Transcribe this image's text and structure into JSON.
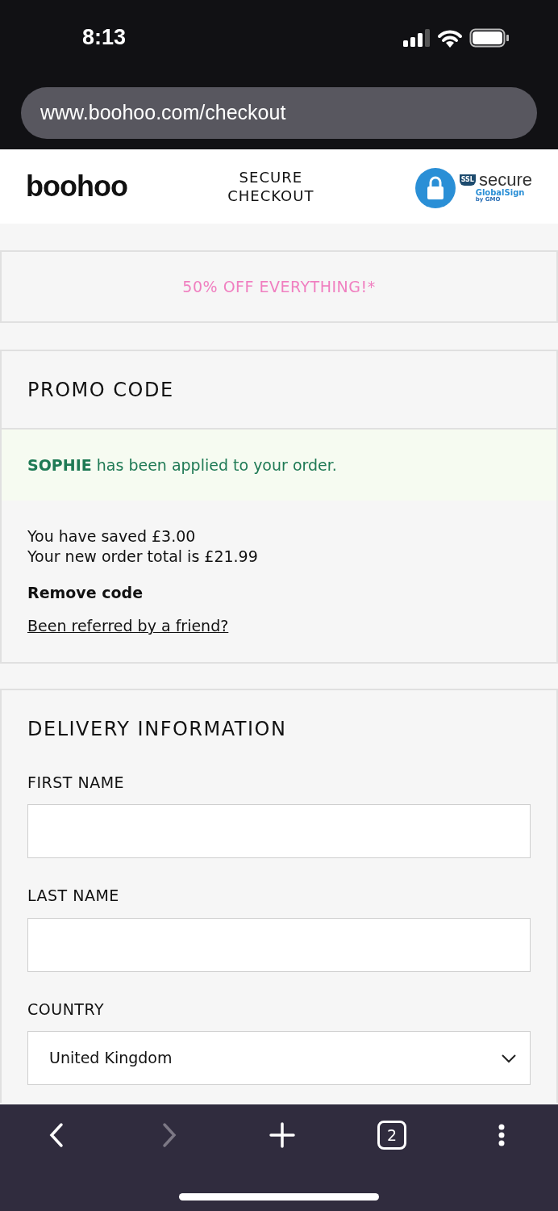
{
  "status_bar": {
    "time": "8:13"
  },
  "browser": {
    "url": "www.boohoo.com/checkout"
  },
  "header": {
    "logo": "boohoo",
    "title_lines": [
      "SECURE",
      "CHECKOUT"
    ],
    "badge": {
      "ssl": "SSL",
      "word": "secure",
      "brand": "GlobalSign",
      "by": "by GMO"
    }
  },
  "banner": {
    "text": "50% OFF EVERYTHING!*"
  },
  "promo": {
    "title": "PROMO CODE",
    "message": "**SOPHIE** has been applied to your order.",
    "saved": "You have saved £3.00",
    "total": "Your new order total is £21.99",
    "remove": "Remove code",
    "referral": "Been referred by a friend?"
  },
  "delivery": {
    "title": "DELIVERY INFORMATION",
    "fields": [
      {
        "kind": "text",
        "label": "FIRST NAME"
      },
      {
        "kind": "text",
        "label": "LAST NAME"
      },
      {
        "kind": "select",
        "label": "COUNTRY",
        "value": "United Kingdom"
      }
    ]
  },
  "toolbar": {
    "buttons": [
      {
        "kind": "back",
        "disabled": false
      },
      {
        "kind": "forward",
        "disabled": true
      },
      {
        "kind": "new-tab",
        "disabled": false
      },
      {
        "kind": "tabs",
        "count": "2",
        "disabled": false
      },
      {
        "kind": "menu",
        "disabled": false
      }
    ]
  }
}
